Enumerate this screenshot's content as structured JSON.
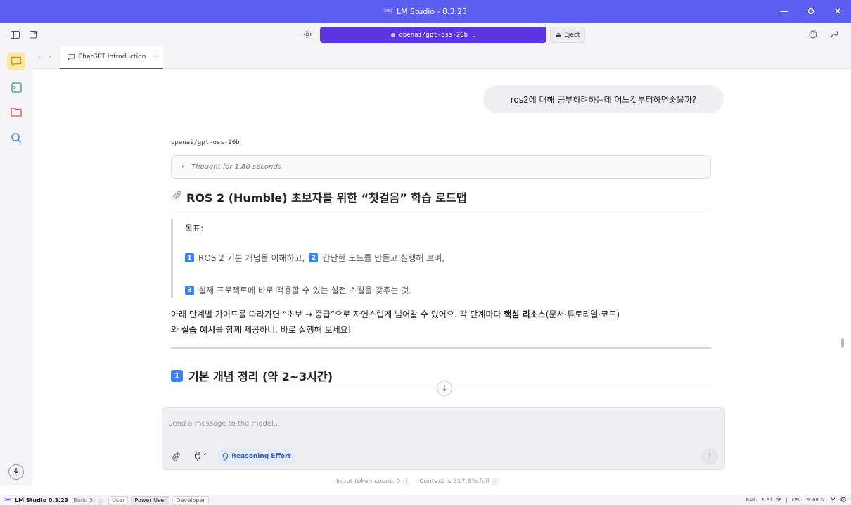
{
  "window": {
    "title": "LM Studio - 0.3.23",
    "minimize": "—",
    "maximize": "▢",
    "close": "✕"
  },
  "toolbar": {
    "model_name": "openai/gpt-oss-20b",
    "eject_label": "Eject"
  },
  "tabs": [
    {
      "label": "ChatGPT Introduction",
      "menu": "···"
    }
  ],
  "chat": {
    "user_message": "ros2에 대해 공부하려하는데 어느것부터하면좋을까?",
    "model_label": "openai/gpt-oss-20b",
    "thought": "Thought for 1.80 seconds",
    "heading": "ROS 2 (Humble) 초보자를 위한 “첫걸음” 학습 로드맵",
    "quote_title": "목표:",
    "quote_item1_num": "1",
    "quote_item1": "ROS 2 기본 개념을 이해하고,",
    "quote_item2_num": "2",
    "quote_item2": "간단한 노드를 만들고 실행해 보며,",
    "quote_item3_num": "3",
    "quote_item3": "실제 프로젝트에 바로 적용할 수 있는 실전 스킬을 갖추는 것.",
    "para_a": "아래 단계별 가이드를 따라가면 “초보 → 중급”으로 자연스럽게 넘어갈 수 있어요. 각 단계마다 ",
    "para_b": "핵심 리소스",
    "para_c": "(문서·튜토리얼·코드)",
    "para_d": "와 ",
    "para_e": "실습 예시",
    "para_f": "를 함께 제공하니, 바로 실행해 보세요!",
    "section_num": "1",
    "section_heading": "기본 개념 정리 (약 2~3시간)"
  },
  "composer": {
    "placeholder": "Send a message to the model...",
    "reasoning_label": "Reasoning Effort"
  },
  "footer": {
    "token_count": "Input token count: 0",
    "context": "Context is 317.6% full"
  },
  "status": {
    "app": "LM Studio 0.3.23",
    "build": "(Build 3)",
    "modes": [
      "User",
      "Power User",
      "Developer"
    ],
    "active_mode": "Power User",
    "ram": "RAM: 3.31 GB",
    "cpu": "CPU: 0.00 %"
  },
  "colors": {
    "titlebar": "#5b5ff0",
    "model_pill": "#5a35e0",
    "chat_active": "#f4c74a",
    "accent_blue": "#3b82f6"
  }
}
